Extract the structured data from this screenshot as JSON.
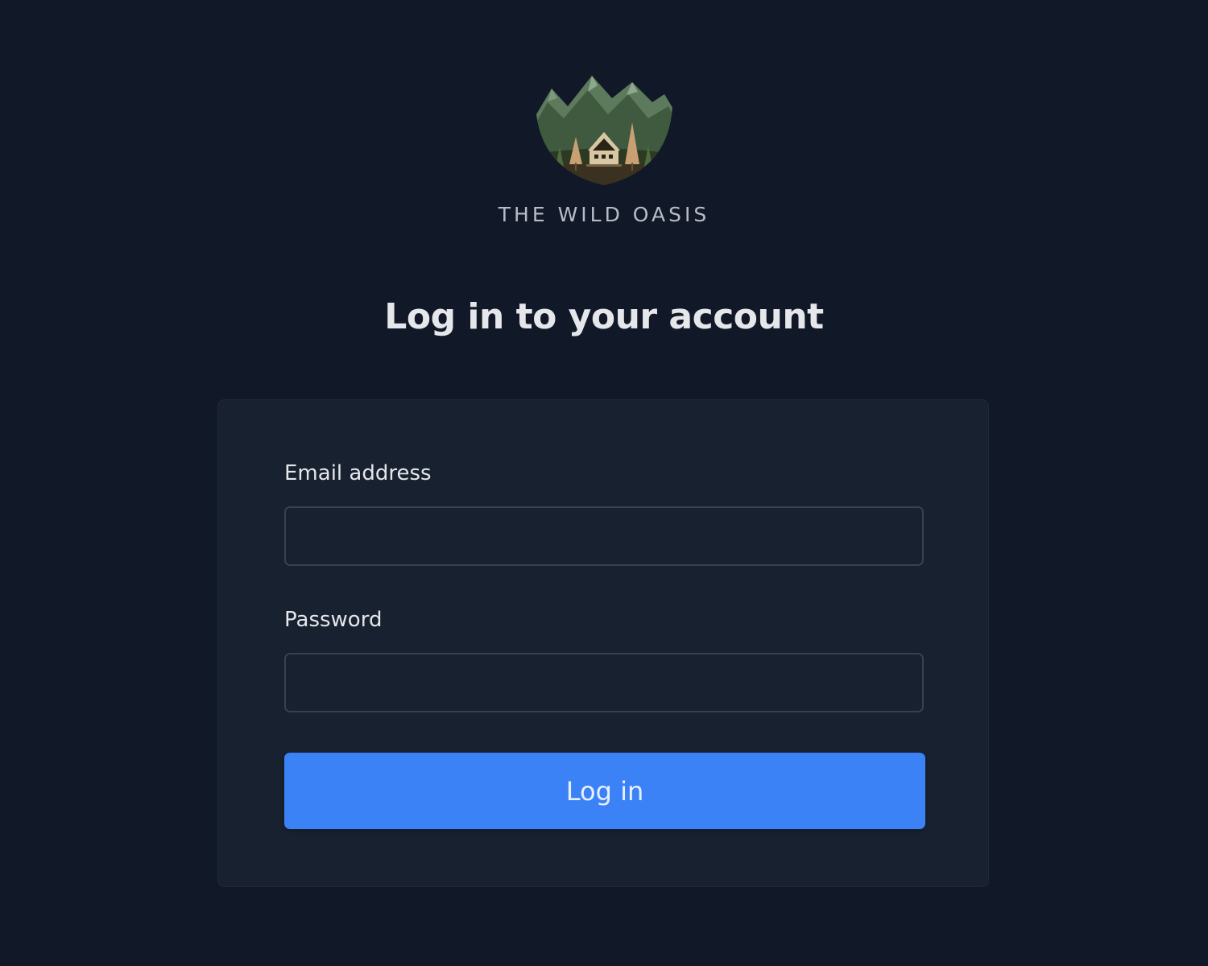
{
  "brand": {
    "logo_icon": "mountain-cabin-logo-icon",
    "name": "THE WILD OASIS"
  },
  "page": {
    "title": "Log in to your account"
  },
  "form": {
    "email": {
      "label": "Email address",
      "value": "",
      "placeholder": ""
    },
    "password": {
      "label": "Password",
      "value": "",
      "placeholder": ""
    },
    "submit_label": "Log in"
  },
  "colors": {
    "background": "#111827",
    "card": "#18212f",
    "accent": "#3b82f6",
    "input_border": "#374151"
  }
}
